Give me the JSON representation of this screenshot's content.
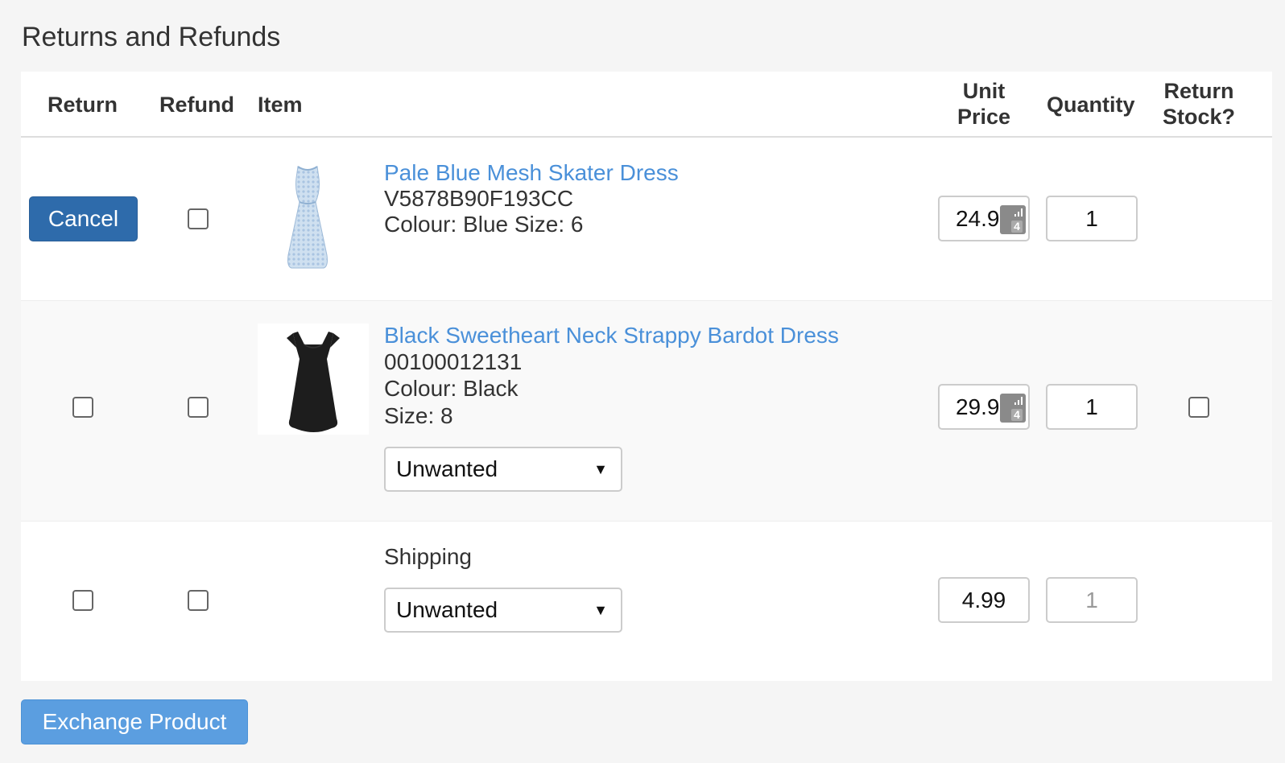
{
  "page": {
    "title": "Returns and Refunds"
  },
  "table": {
    "headers": {
      "return": "Return",
      "refund": "Refund",
      "item": "Item",
      "unit_price_line1": "Unit",
      "unit_price_line2": "Price",
      "quantity": "Quantity",
      "return_stock_line1": "Return",
      "return_stock_line2": "Stock?"
    },
    "rows": [
      {
        "return_action": "Cancel",
        "refund_checked": false,
        "image_icon": "blue-dress-image",
        "name": "Pale Blue Mesh Skater Dress",
        "sku": "V5878B90F193CC",
        "details": "Colour: Blue Size: 6",
        "unit_price": "24.99",
        "quantity": "1",
        "password_manager_badge": "4"
      },
      {
        "return_checked": false,
        "refund_checked": false,
        "image_icon": "black-dress-image",
        "name": "Black Sweetheart Neck Strappy Bardot Dress",
        "sku": "00100012131",
        "colour": "Colour: Black",
        "size": "Size: 8",
        "reason": "Unwanted",
        "unit_price": "29.99",
        "quantity": "1",
        "return_stock_checked": false,
        "password_manager_badge": "4"
      },
      {
        "return_checked": false,
        "refund_checked": false,
        "label": "Shipping",
        "reason": "Unwanted",
        "unit_price": "4.99",
        "quantity": "1"
      }
    ]
  },
  "actions": {
    "exchange_label": "Exchange Product"
  },
  "colors": {
    "primary": "#2e6bab",
    "link": "#4a90d9",
    "exchange": "#5b9ee0"
  }
}
